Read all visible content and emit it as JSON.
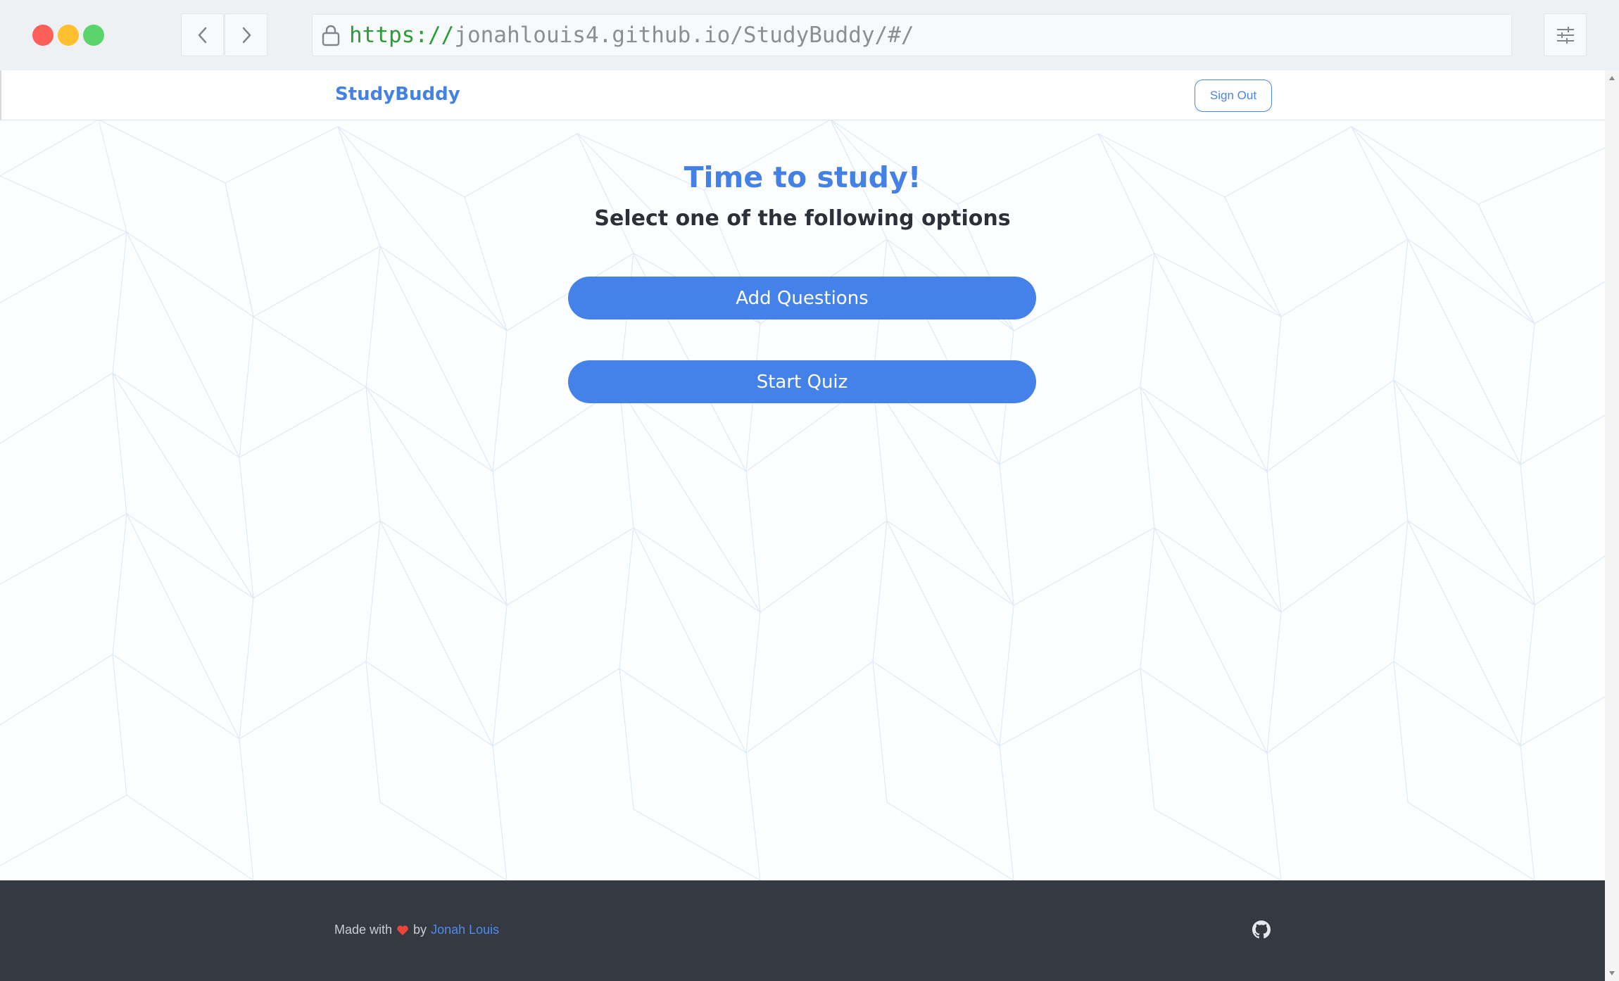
{
  "browser": {
    "url_scheme": "https://",
    "url_rest": "jonahlouis4.github.io/StudyBuddy/#/"
  },
  "navbar": {
    "brand": "StudyBuddy",
    "signout_label": "Sign Out"
  },
  "main": {
    "title": "Time to study!",
    "subtitle": "Select one of the following options",
    "add_questions_label": "Add Questions",
    "start_quiz_label": "Start Quiz"
  },
  "footer": {
    "made_with": "Made with",
    "by": "by",
    "author": "Jonah Louis",
    "heart_icon": "heart-icon",
    "github_icon": "github-icon"
  },
  "colors": {
    "accent": "#4482ea",
    "footer_bg": "#353a42",
    "heart": "#e8443a"
  }
}
